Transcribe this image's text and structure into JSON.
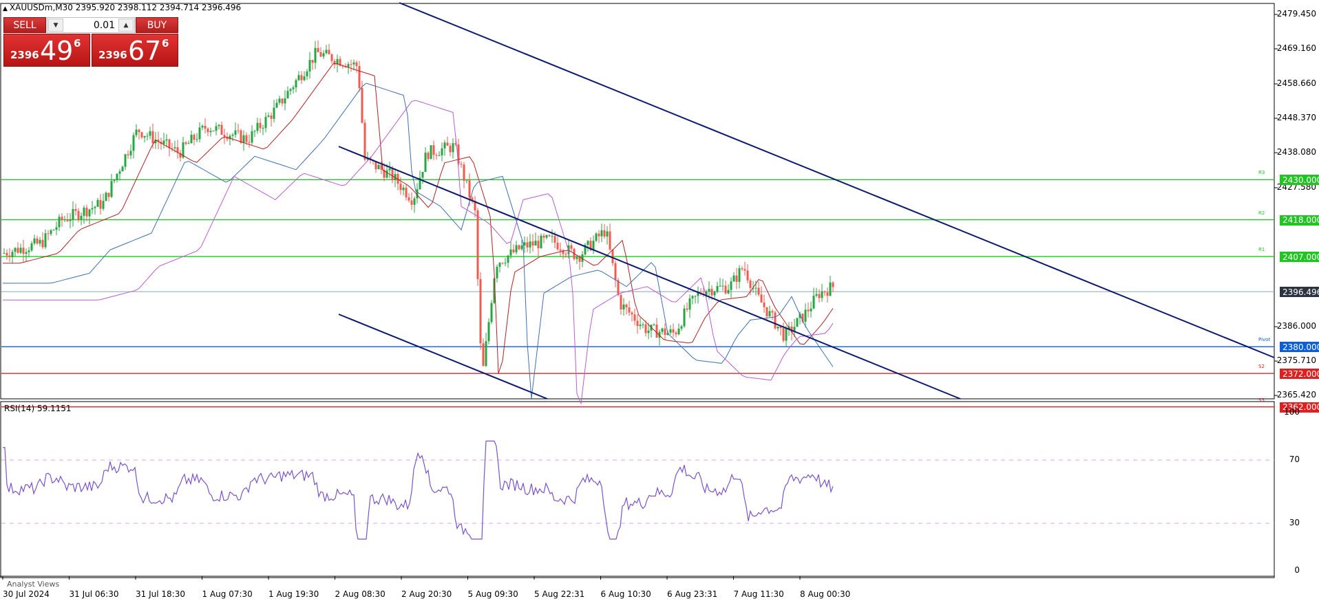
{
  "header": {
    "symbol_line": "XAUUSDm,M30  2395.920 2398.112 2394.714 2396.496"
  },
  "trade_panel": {
    "sell_label": "SELL",
    "buy_label": "BUY",
    "lot": "0.01",
    "sell_price": {
      "prefix": "2396",
      "big": "49",
      "sup": "6"
    },
    "buy_price": {
      "prefix": "2396",
      "big": "67",
      "sup": "6"
    }
  },
  "price_axis": [
    "2479.450",
    "2469.160",
    "2458.660",
    "2448.370",
    "2438.080",
    "2427.580",
    "2386.000",
    "2375.710",
    "2365.420"
  ],
  "levels": [
    {
      "label": "2430.000",
      "tag": "R3",
      "color": "#21c521"
    },
    {
      "label": "2418.000",
      "tag": "R2",
      "color": "#21c521"
    },
    {
      "label": "2407.000",
      "tag": "R1",
      "color": "#21c521"
    },
    {
      "label": "2380.000",
      "tag": "Pivot",
      "color": "#0a5fd6"
    },
    {
      "label": "2372.000",
      "tag": "S2",
      "color": "#e02020"
    },
    {
      "label": "2362.000",
      "tag": "S3",
      "color": "#e02020"
    }
  ],
  "current_price": "2396.496",
  "rsi": {
    "label": "RSI(14) 59.1151",
    "axis": [
      "100",
      "70",
      "30",
      "0"
    ]
  },
  "time_axis": [
    "30 Jul 2024",
    "31 Jul 06:30",
    "31 Jul 18:30",
    "1 Aug 07:30",
    "1 Aug 19:30",
    "2 Aug 08:30",
    "2 Aug 20:30",
    "5 Aug 09:30",
    "5 Aug 22:31",
    "6 Aug 10:30",
    "6 Aug 23:31",
    "7 Aug 11:30",
    "8 Aug 00:30"
  ],
  "analyst_label": "Analyst Views",
  "colors": {
    "bull": "#26a541",
    "bear": "#f15a4e",
    "ma_fast": "#b22020",
    "ma_mid": "#3c6fb0",
    "ma_slow": "#b85cd0",
    "channel": "#0b1a6e",
    "rsi": "#7b52c9"
  }
}
